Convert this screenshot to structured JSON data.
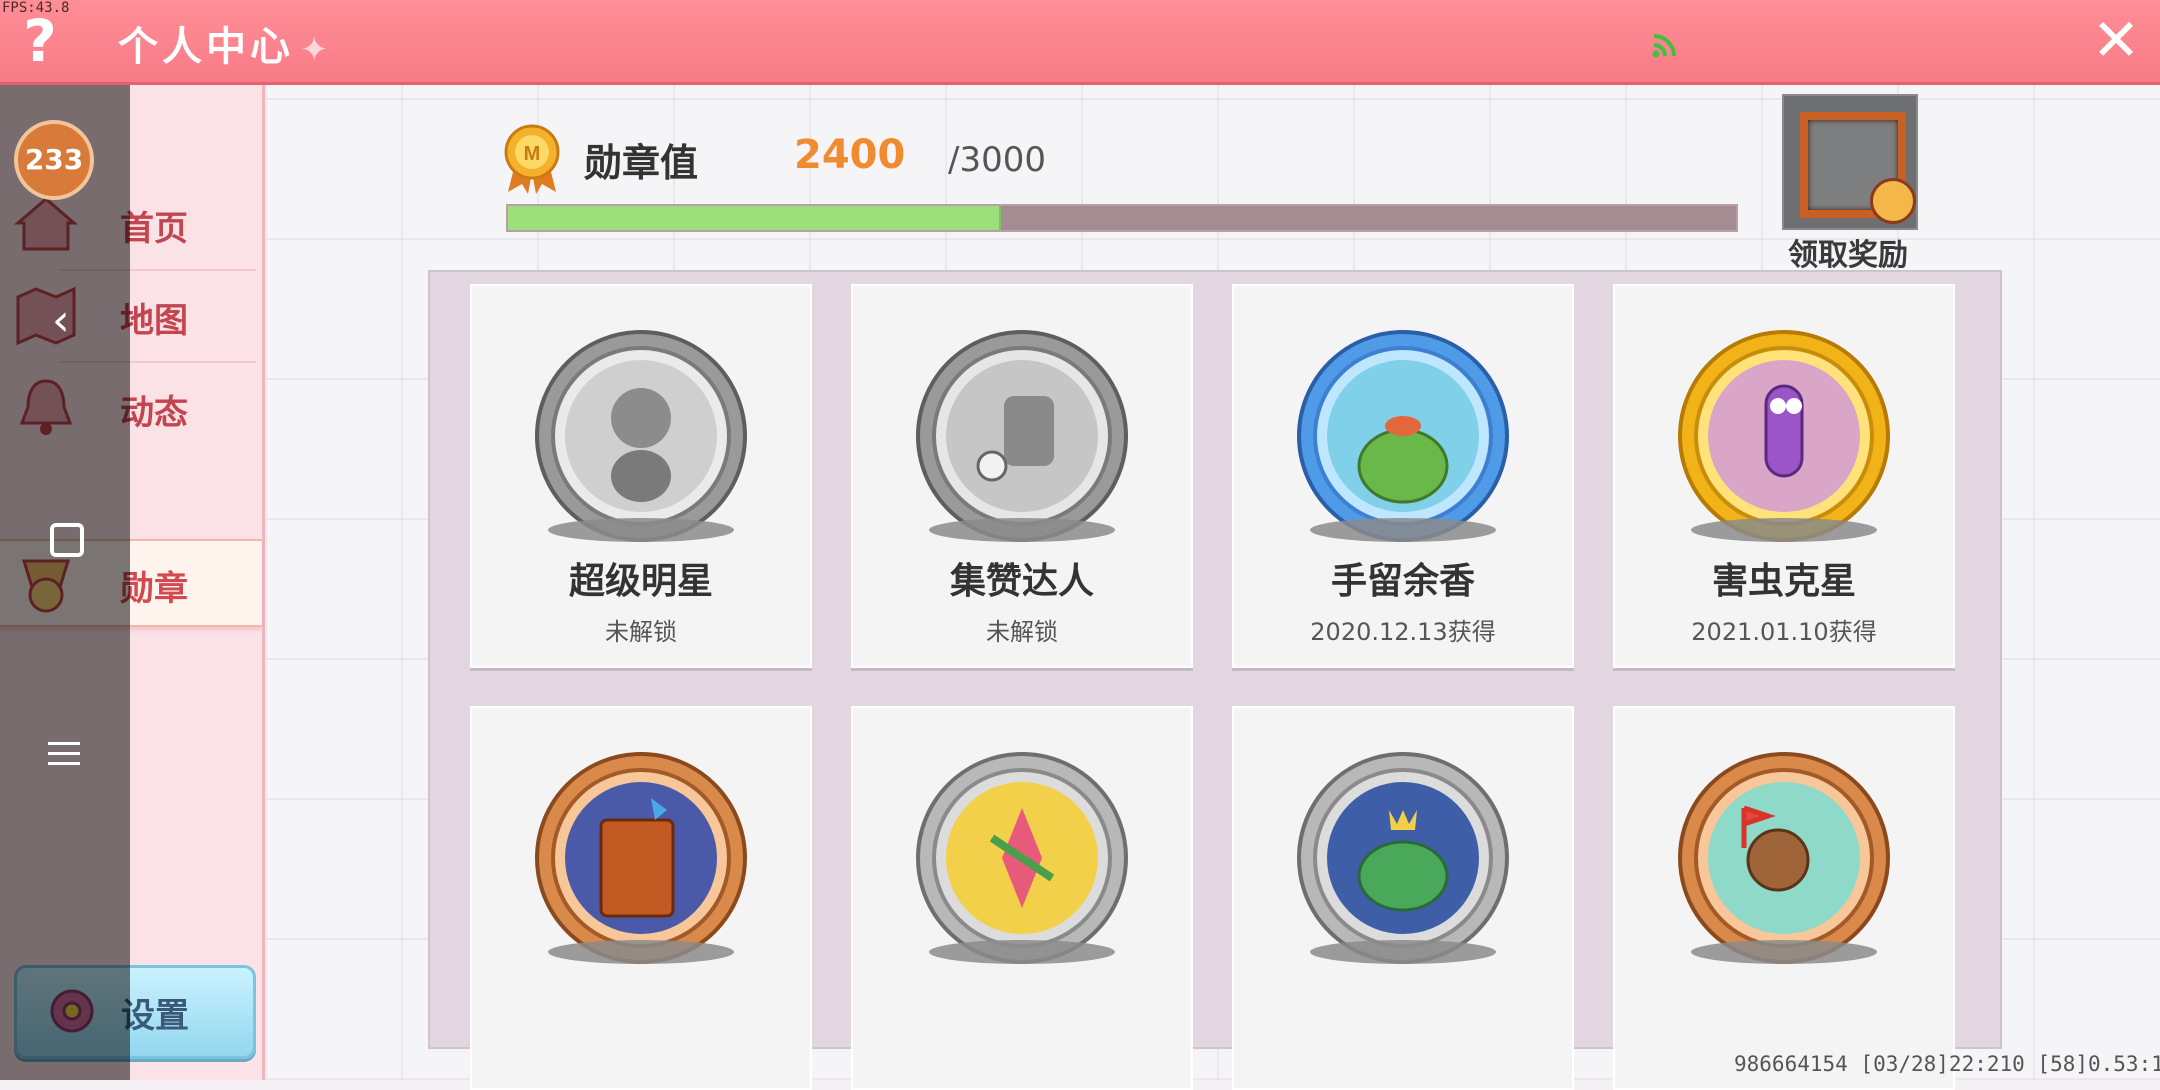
{
  "debug": {
    "fps": "FPS:43.8"
  },
  "header": {
    "help_label": "?",
    "title": "个人中心",
    "close_label": "✕",
    "wifi_icon": "wifi-signal-icon"
  },
  "profile": {
    "level": "233"
  },
  "sidebar": {
    "items": [
      {
        "label": "首页",
        "icon": "home-icon",
        "active": false
      },
      {
        "label": "地图",
        "icon": "map-icon",
        "active": false
      },
      {
        "label": "动态",
        "icon": "bell-icon",
        "active": false
      },
      {
        "label": "勋章",
        "icon": "medal-icon",
        "active": true
      }
    ],
    "settings_label": "设置"
  },
  "medal_value": {
    "label": "勋章值",
    "current": "2400",
    "max": "/3000",
    "progress_ratio": 0.4
  },
  "reward": {
    "label": "领取奖励"
  },
  "badges": [
    {
      "name": "超级明星",
      "status": "未解锁",
      "style": "locked"
    },
    {
      "name": "集赞达人",
      "status": "未解锁",
      "style": "locked"
    },
    {
      "name": "手留余香",
      "status": "2020.12.13获得",
      "style": "diamond"
    },
    {
      "name": "害虫克星",
      "status": "2021.01.10获得",
      "style": "gold"
    },
    {
      "name": "",
      "status": "",
      "style": "bronze"
    },
    {
      "name": "",
      "status": "",
      "style": "silver"
    },
    {
      "name": "",
      "status": "",
      "style": "silver"
    },
    {
      "name": "",
      "status": "",
      "style": "bronze"
    }
  ],
  "footer": {
    "info": "986664154   [03/28]22:210  [58]0.53:1"
  },
  "colors": {
    "header": "#f77b86",
    "accent_orange": "#f08b2f",
    "progress_fill": "#9de07b",
    "nav_text": "#c2454f"
  }
}
